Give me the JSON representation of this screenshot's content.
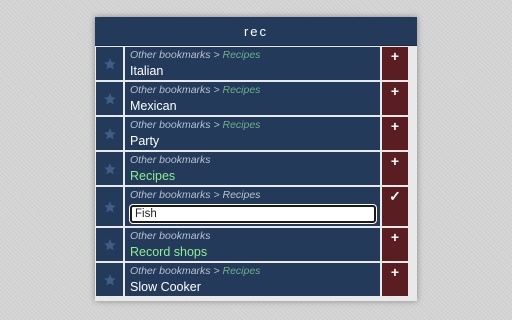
{
  "header": {
    "title": "rec"
  },
  "rows": [
    {
      "path_prefix": "Other bookmarks",
      "separator": " > ",
      "path_folder": "Recipes",
      "title": "Italian",
      "is_folder": false,
      "action": "+"
    },
    {
      "path_prefix": "Other bookmarks",
      "separator": " > ",
      "path_folder": "Recipes",
      "title": "Mexican",
      "is_folder": false,
      "action": "+"
    },
    {
      "path_prefix": "Other bookmarks",
      "separator": " > ",
      "path_folder": "Recipes",
      "title": "Party",
      "is_folder": false,
      "action": "+"
    },
    {
      "path_prefix": "Other bookmarks",
      "title": "Recipes",
      "is_folder": true,
      "action": "+"
    },
    {
      "path_prefix": "Other bookmarks",
      "separator": " > ",
      "path_folder": "Recipes",
      "input_value": "Fish",
      "editing": true,
      "action": "✓"
    },
    {
      "path_prefix": "Other bookmarks",
      "title": "Record shops",
      "is_folder": true,
      "action": "+"
    },
    {
      "path_prefix": "Other bookmarks",
      "separator": " > ",
      "path_folder": "Recipes",
      "title": "Slow Cooker",
      "is_folder": false,
      "action": "+"
    }
  ],
  "colors": {
    "header_bg": "#233a5b",
    "row_bg": "#233a5b",
    "action_bg": "#5a1e22",
    "folder_text": "#8cf08c",
    "path_folder_text": "#6ab08a"
  },
  "icons": {
    "star": "star-icon",
    "add": "plus-icon",
    "confirm": "check-icon"
  }
}
